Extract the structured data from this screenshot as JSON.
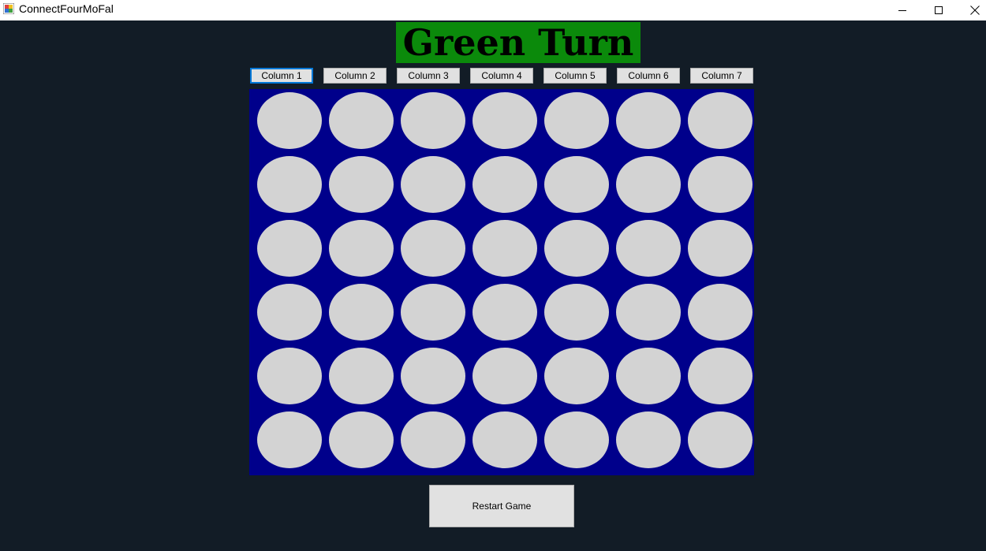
{
  "window": {
    "title": "ConnectFourMoFal",
    "controls": [
      "minimize",
      "maximize",
      "close"
    ]
  },
  "status": {
    "turn_text": "Green Turn",
    "turn_color": "#0b8a0b"
  },
  "columns": [
    {
      "label": "Column 1"
    },
    {
      "label": "Column 2"
    },
    {
      "label": "Column 3"
    },
    {
      "label": "Column 4"
    },
    {
      "label": "Column 5"
    },
    {
      "label": "Column 6"
    },
    {
      "label": "Column 7"
    }
  ],
  "board": {
    "rows": 6,
    "cols": 7,
    "background": "#00008b",
    "empty_color": "#d3d3d3",
    "cells": [
      [
        "empty",
        "empty",
        "empty",
        "empty",
        "empty",
        "empty",
        "empty"
      ],
      [
        "empty",
        "empty",
        "empty",
        "empty",
        "empty",
        "empty",
        "empty"
      ],
      [
        "empty",
        "empty",
        "empty",
        "empty",
        "empty",
        "empty",
        "empty"
      ],
      [
        "empty",
        "empty",
        "empty",
        "empty",
        "empty",
        "empty",
        "empty"
      ],
      [
        "empty",
        "empty",
        "empty",
        "empty",
        "empty",
        "empty",
        "empty"
      ],
      [
        "empty",
        "empty",
        "empty",
        "empty",
        "empty",
        "empty",
        "empty"
      ]
    ]
  },
  "actions": {
    "restart_label": "Restart Game"
  }
}
